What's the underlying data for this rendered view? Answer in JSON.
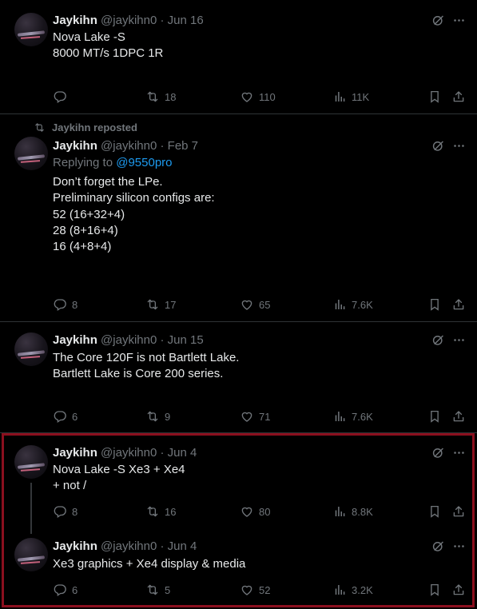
{
  "tweets": [
    {
      "name": "Jaykihn",
      "handle": "@jaykihn0",
      "date": "Jun 16",
      "lines": [
        "Nova Lake -S",
        "",
        "8000 MT/s 1DPC 1R"
      ],
      "reply_count": "",
      "repost_count": "18",
      "like_count": "110",
      "view_count": "11K"
    },
    {
      "repost_label": "Jaykihn reposted",
      "name": "Jaykihn",
      "handle": "@jaykihn0",
      "date": "Feb 7",
      "replying_prefix": "Replying to",
      "replying_to": "@9550pro",
      "lines": [
        "Don’t forget the LPe.",
        "",
        "Preliminary silicon configs are:",
        "",
        "52 (16+32+4)",
        "28 (8+16+4)",
        "16 (4+8+4)"
      ],
      "reply_count": "8",
      "repost_count": "17",
      "like_count": "65",
      "view_count": "7.6K"
    },
    {
      "name": "Jaykihn",
      "handle": "@jaykihn0",
      "date": "Jun 15",
      "lines": [
        "The Core 120F is not Bartlett Lake.",
        "",
        "Bartlett Lake is Core 200 series."
      ],
      "reply_count": "6",
      "repost_count": "9",
      "like_count": "71",
      "view_count": "7.6K"
    },
    {
      "name": "Jaykihn",
      "handle": "@jaykihn0",
      "date": "Jun 4",
      "lines": [
        "Nova Lake -S Xe3 + Xe4",
        "+ not /"
      ],
      "reply_count": "8",
      "repost_count": "16",
      "like_count": "80",
      "view_count": "8.8K"
    },
    {
      "name": "Jaykihn",
      "handle": "@jaykihn0",
      "date": "Jun 4",
      "lines": [
        "Xe3 graphics + Xe4 display & media"
      ],
      "reply_count": "6",
      "repost_count": "5",
      "like_count": "52",
      "view_count": "3.2K"
    }
  ],
  "separator": "·",
  "colors": {
    "background": "#000000",
    "text": "#e7e9ea",
    "muted": "#71767b",
    "link": "#1d9bf0",
    "highlight_border": "#8b0f1e"
  },
  "icons": [
    "grok-icon",
    "more-icon",
    "reply-icon",
    "repost-icon",
    "like-icon",
    "views-icon",
    "bookmark-icon",
    "share-icon"
  ]
}
